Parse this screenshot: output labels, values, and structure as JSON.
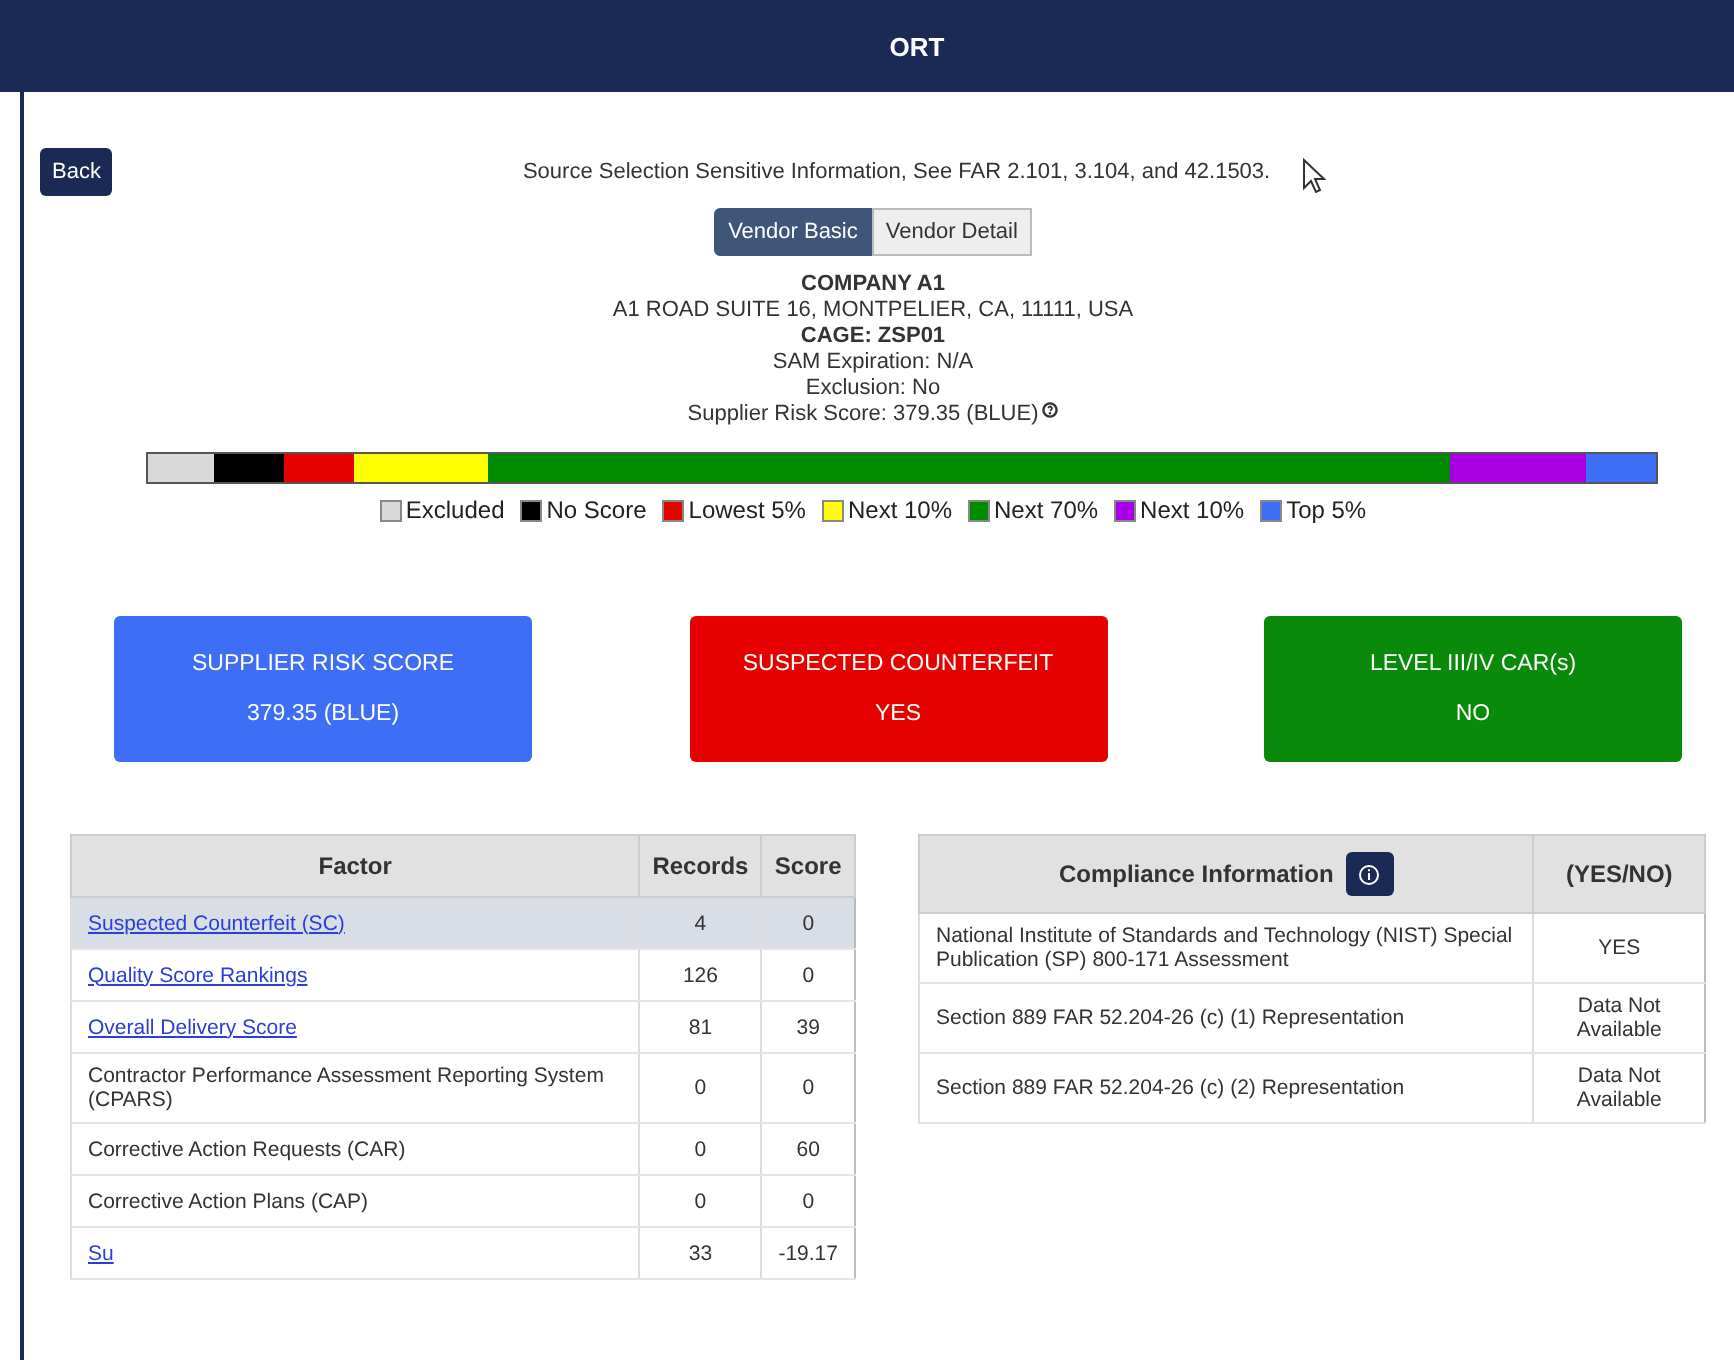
{
  "header": {
    "title": "ORT"
  },
  "back_button": "Back",
  "notice": "Source Selection Sensitive Information, See FAR 2.101, 3.104, and 42.1503.",
  "tabs": [
    {
      "label": "Vendor Basic",
      "selected": true
    },
    {
      "label": "Vendor Detail",
      "selected": false
    }
  ],
  "vendor": {
    "name": "COMPANY A1",
    "address": "A1 ROAD SUITE 16, MONTPELIER, CA, 11111, USA",
    "cage": "CAGE: ZSP01",
    "sam_expiration": "SAM Expiration: N/A",
    "exclusion": "Exclusion: No",
    "risk_score": "Supplier Risk Score: 379.35 (BLUE)"
  },
  "scale": [
    {
      "label": "Excluded",
      "color": "#d9d9d9"
    },
    {
      "label": "No Score",
      "color": "#000000"
    },
    {
      "label": "Lowest 5%",
      "color": "#e60000"
    },
    {
      "label": "Next 10%",
      "color": "#ffff00"
    },
    {
      "label": "Next 70%",
      "color": "#008a00"
    },
    {
      "label": "Next 10%",
      "color": "#a800e6"
    },
    {
      "label": "Top 5%",
      "color": "#3d6ef5"
    }
  ],
  "cards": [
    {
      "title": "SUPPLIER RISK SCORE",
      "value": "379.35 (BLUE)",
      "color": "#3d6ef5"
    },
    {
      "title": "SUSPECTED COUNTERFEIT",
      "value": "YES",
      "color": "#e60000"
    },
    {
      "title": "LEVEL III/IV CAR(s)",
      "value": "NO",
      "color": "#0a8a0a"
    }
  ],
  "factor_table": {
    "columns": [
      "Factor",
      "Records",
      "Score"
    ],
    "rows": [
      {
        "factor": "Suspected Counterfeit (SC)",
        "kind": "link",
        "records": "4",
        "score": "0",
        "selected": true
      },
      {
        "factor": "Quality Score Rankings",
        "kind": "link",
        "records": "126",
        "score": "0",
        "selected": false
      },
      {
        "factor": "Overall Delivery Score",
        "kind": "link",
        "records": "81",
        "score": "39",
        "selected": false
      },
      {
        "factor": "Contractor Performance Assessment Reporting System (CPARS)",
        "kind": "text",
        "records": "0",
        "score": "0",
        "selected": false
      },
      {
        "factor": "Corrective Action Requests (CAR)",
        "kind": "text",
        "records": "0",
        "score": "60",
        "selected": false
      },
      {
        "factor": "Corrective Action Plans (CAP)",
        "kind": "text",
        "records": "0",
        "score": "0",
        "selected": false
      },
      {
        "factor": "Su",
        "kind": "link",
        "records": "33",
        "score": "-19.17",
        "selected": false
      }
    ]
  },
  "compliance_table": {
    "columns": [
      "Compliance Information",
      "(YES/NO)"
    ],
    "rows": [
      {
        "item": "National Institute of Standards and Technology (NIST) Special Publication (SP) 800-171 Assessment",
        "value": "YES"
      },
      {
        "item": "Section 889 FAR 52.204-26 (c) (1) Representation",
        "value": "Data Not Available"
      },
      {
        "item": "Section 889 FAR 52.204-26 (c) (2) Representation",
        "value": "Data Not Available"
      }
    ]
  }
}
